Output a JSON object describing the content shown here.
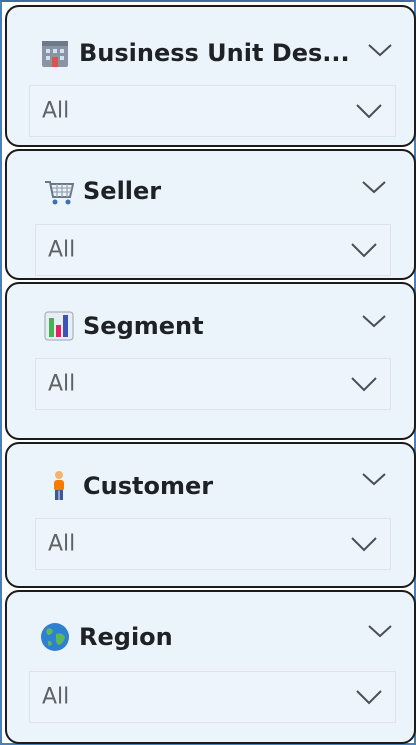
{
  "slicers": [
    {
      "title": "Business Unit Des...",
      "icon": "office-building-icon",
      "value": "All"
    },
    {
      "title": "Seller",
      "icon": "shopping-cart-icon",
      "value": "All"
    },
    {
      "title": "Segment",
      "icon": "bar-chart-icon",
      "value": "All"
    },
    {
      "title": "Customer",
      "icon": "person-icon",
      "value": "All"
    },
    {
      "title": "Region",
      "icon": "globe-icon",
      "value": "All"
    }
  ],
  "colors": {
    "card_bg": "#ebf3fb",
    "card_border": "#1b1b1b",
    "text": "#1e2226",
    "placeholder": "#5f6368"
  }
}
